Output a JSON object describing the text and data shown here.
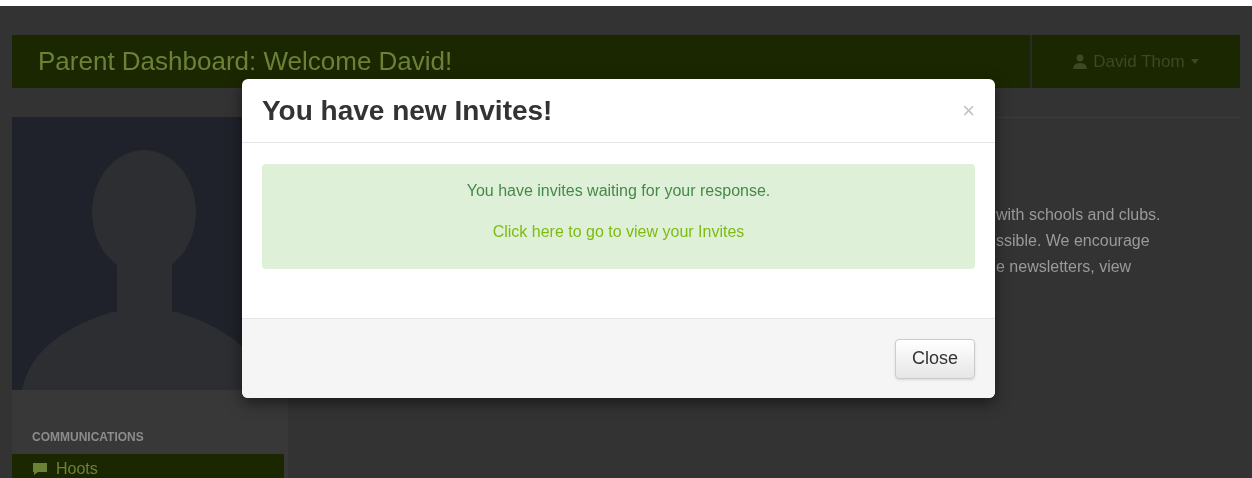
{
  "navbar": {
    "title": "Parent Dashboard: Welcome David!",
    "user_menu": "David Thom"
  },
  "sidebar": {
    "section_heading": "COMMUNICATIONS",
    "items": [
      {
        "label": "Hoots",
        "selected": true
      }
    ]
  },
  "content": {
    "lines": [
      "with schools and clubs.",
      "ssible. We encourage",
      "e newsletters, view"
    ]
  },
  "modal": {
    "title": "You have new Invites!",
    "close_symbol": "×",
    "message": "You have invites waiting for your response.",
    "link": "Click here to go to view your Invites",
    "button": "Close"
  }
}
